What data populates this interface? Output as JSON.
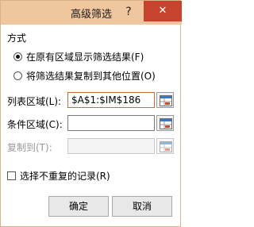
{
  "window": {
    "title": "高级筛选",
    "help_icon": "?",
    "close_icon": "✕"
  },
  "mode_group": {
    "title": "方式",
    "options": [
      {
        "label": "在原有区域显示筛选结果(F)",
        "selected": true
      },
      {
        "label": "将筛选结果复制到其他位置(O)",
        "selected": false
      }
    ]
  },
  "fields": {
    "list_range": {
      "label": "列表区域(L):",
      "value": "$A$1:$IM$186"
    },
    "criteria_range": {
      "label": "条件区域(C):",
      "value": ""
    },
    "copy_to": {
      "label": "复制到(T):",
      "value": ""
    }
  },
  "unique_records": {
    "label": "选择不重复的记录(R)",
    "checked": false
  },
  "buttons": {
    "ok": "确定",
    "cancel": "取消"
  },
  "colors": {
    "titlebar": "#f0c69e",
    "close_button": "#c7432e",
    "focus_border": "#d06a3a"
  }
}
